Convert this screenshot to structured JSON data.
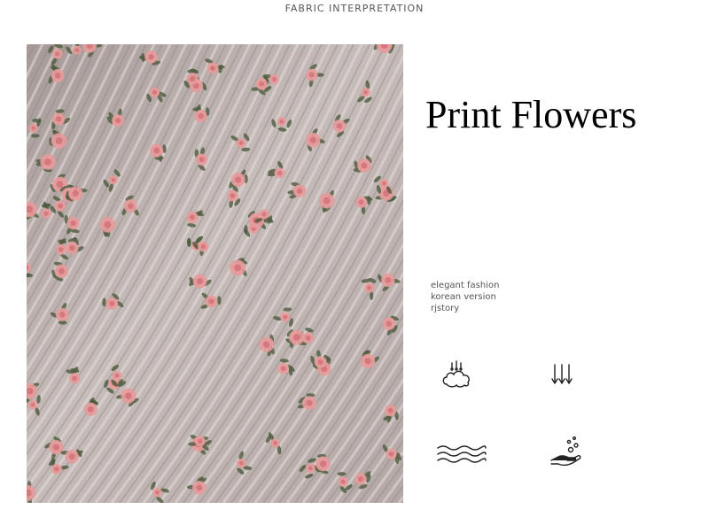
{
  "header": {
    "label": "FABRIC INTERPRETATION"
  },
  "photo": {
    "subject": "pleated-floral-chiffon-fabric",
    "colors": {
      "base": "#b8adab",
      "pleat_light": "#e6dfdc",
      "pleat_dark": "#8f8583",
      "flower": "#e79a9a",
      "flower_center": "#d06a70",
      "leaf": "#4f5b3e"
    }
  },
  "title": "Print Flowers",
  "tagline": [
    "elegant fashion",
    "korean version",
    "rjstory"
  ],
  "care_icons": [
    {
      "name": "cloud-steam-icon"
    },
    {
      "name": "down-arrows-icon"
    },
    {
      "name": "water-waves-icon"
    },
    {
      "name": "hand-bubbles-icon"
    }
  ]
}
